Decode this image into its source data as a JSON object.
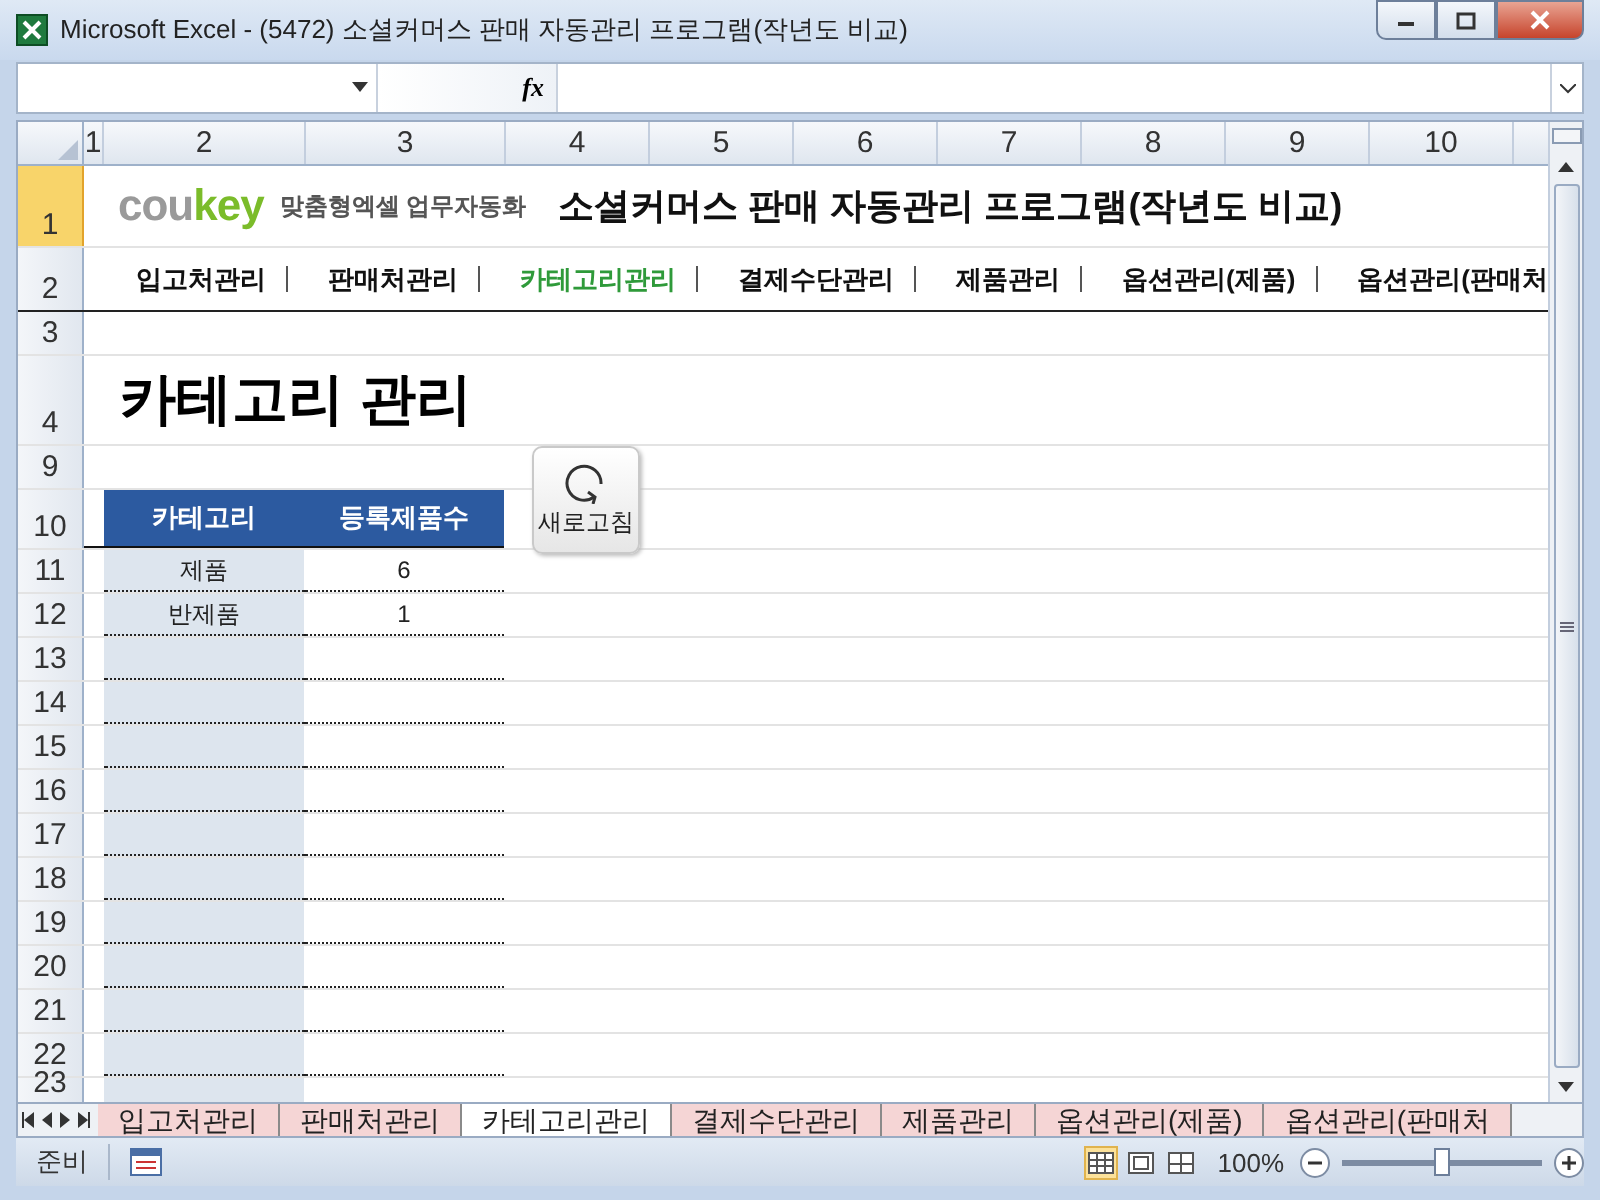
{
  "window": {
    "title": "Microsoft Excel - (5472) 소셜커머스 판매 자동관리 프로그램(작년도 비교)"
  },
  "formula_bar": {
    "function_label": "fx"
  },
  "columns": [
    "1",
    "2",
    "3",
    "4",
    "5",
    "6",
    "7",
    "8",
    "9",
    "10"
  ],
  "row_numbers": [
    "1",
    "2",
    "3",
    "4",
    "9",
    "10",
    "11",
    "12",
    "13",
    "14",
    "15",
    "16",
    "17",
    "18",
    "19",
    "20",
    "21",
    "22",
    "23"
  ],
  "sheet": {
    "brand": {
      "plain": "cou",
      "accent": "key"
    },
    "tagline": "맞춤형엑셀 업무자동화",
    "title": "소셜커머스 판매 자동관리 프로그램(작년도 비교)",
    "nav": [
      {
        "label": "입고처관리",
        "selected": false
      },
      {
        "label": "판매처관리",
        "selected": false
      },
      {
        "label": "카테고리관리",
        "selected": true
      },
      {
        "label": "결제수단관리",
        "selected": false
      },
      {
        "label": "제품관리",
        "selected": false
      },
      {
        "label": "옵션관리(제품)",
        "selected": false
      },
      {
        "label": "옵션관리(판매처",
        "selected": false
      }
    ],
    "heading": "카테고리 관리",
    "refresh_button": "새로고침",
    "table": {
      "columns": [
        "카테고리",
        "등록제품수"
      ],
      "rows": [
        [
          "제품",
          "6"
        ],
        [
          "반제품",
          "1"
        ]
      ]
    }
  },
  "sheet_tabs": [
    {
      "label": "입고처관리",
      "selected": false
    },
    {
      "label": "판매처관리",
      "selected": false
    },
    {
      "label": "카테고리관리",
      "selected": true
    },
    {
      "label": "결제수단관리",
      "selected": false
    },
    {
      "label": "제품관리",
      "selected": false
    },
    {
      "label": "옵션관리(제품)",
      "selected": false
    },
    {
      "label": "옵션관리(판매처",
      "selected": false
    }
  ],
  "status_bar": {
    "mode": "준비",
    "zoom": "100%",
    "zoom_slider": {
      "level": 0.5
    }
  }
}
